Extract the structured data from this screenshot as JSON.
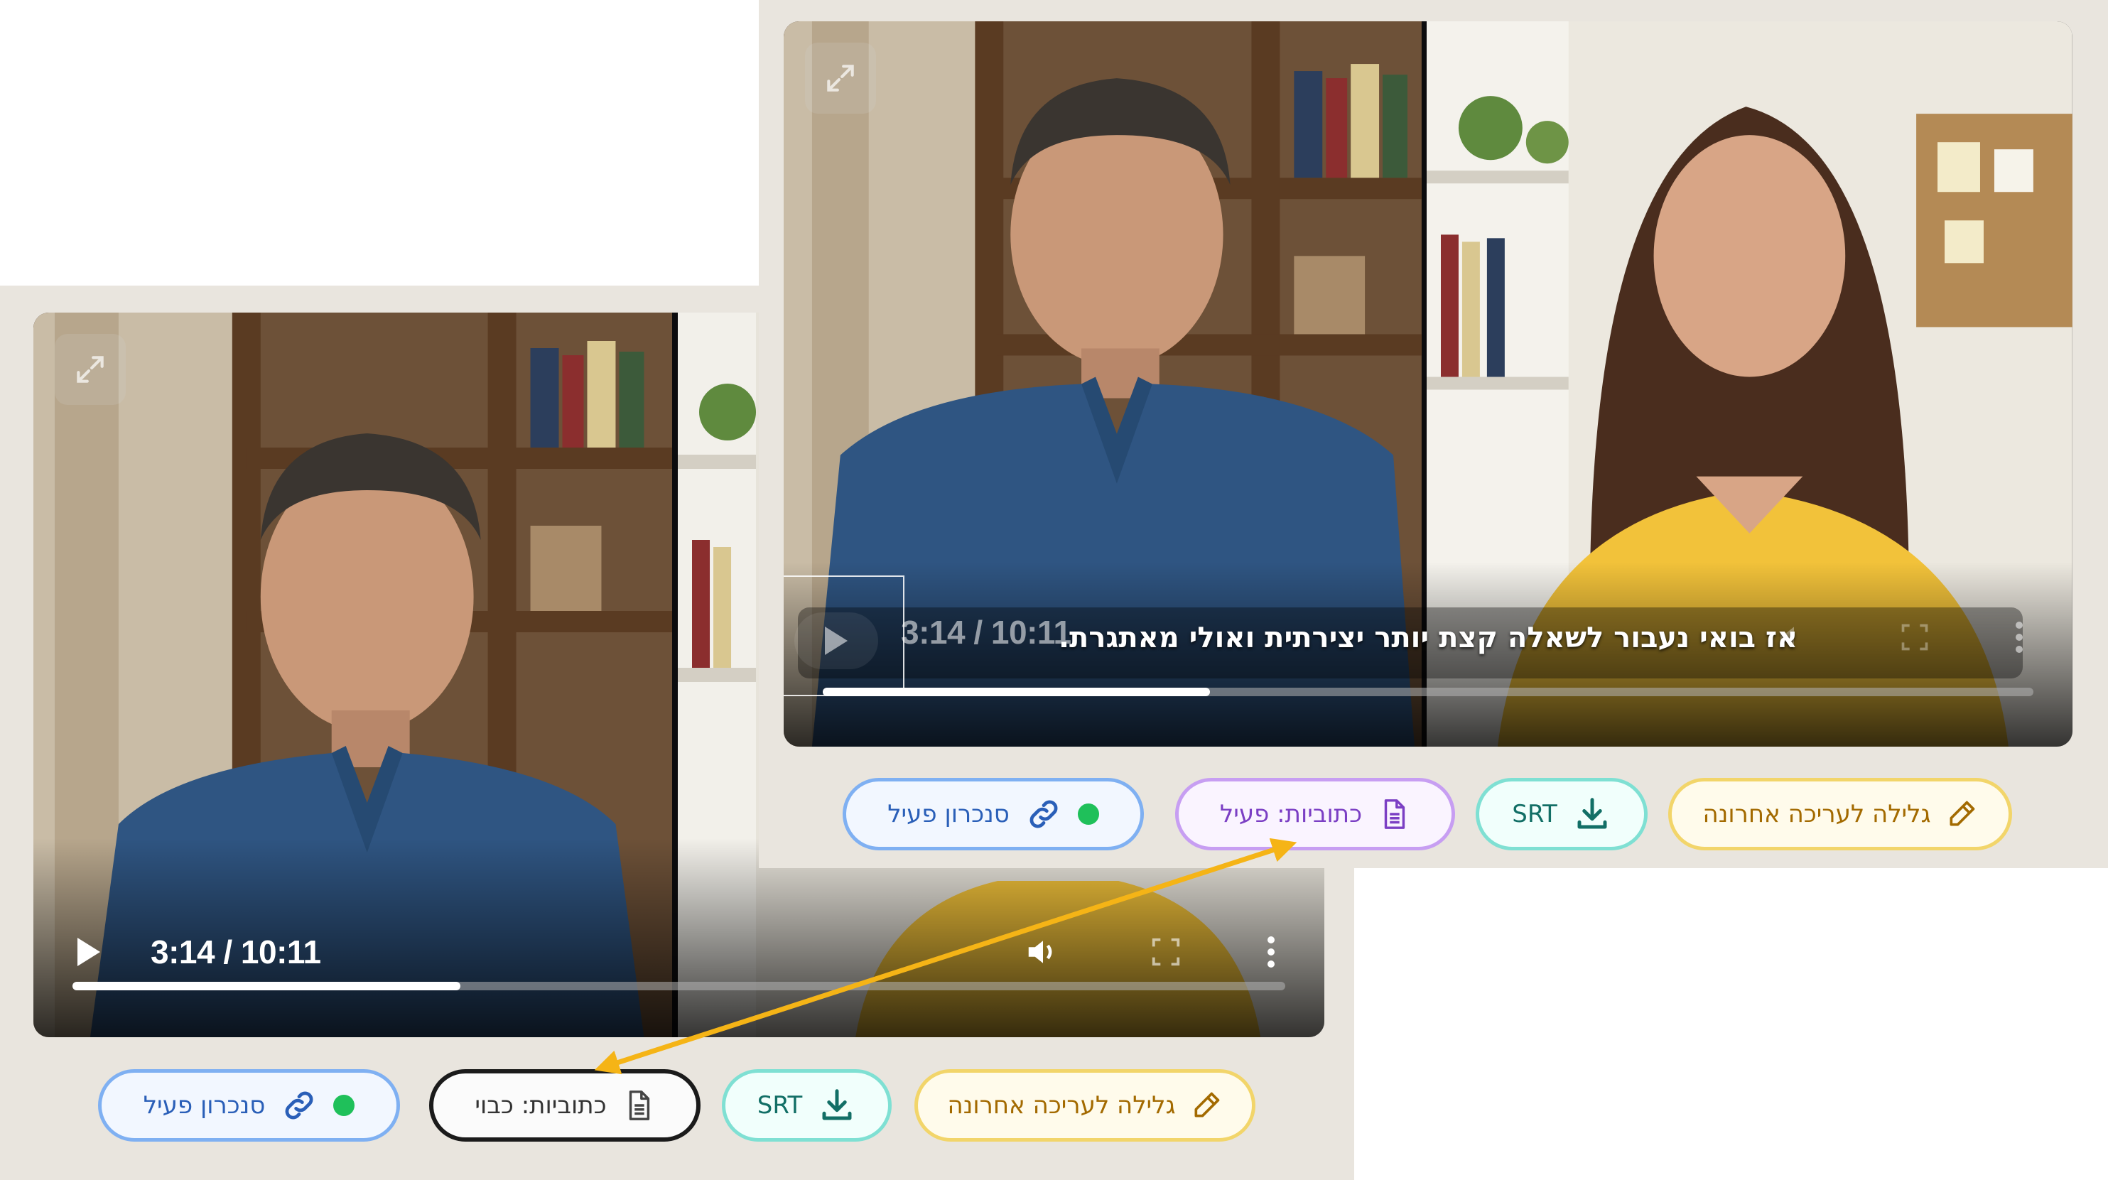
{
  "back_panel": {
    "player": {
      "time": "3:14 / 10:11",
      "progress_fraction": 0.32
    },
    "buttons": {
      "sync": "סנכרון פעיל",
      "captions": "כתוביות: כבוי",
      "srt": "SRT",
      "scroll": "גלילה לעריכה אחרונה"
    }
  },
  "front_panel": {
    "player": {
      "time": "3:14 / 10:11",
      "subtitle": "אז בואי נעבור לשאלה קצת יותר יצירתית ואולי מאתגרת.",
      "progress_fraction": 0.32
    },
    "buttons": {
      "sync": "סנכרון פעיל",
      "captions": "כתוביות: פעיל",
      "srt": "SRT",
      "scroll": "גלילה לעריכה אחרונה"
    }
  },
  "colors": {
    "panel_bg": "#e9e5de",
    "arrow": "#f5b416",
    "sync_border": "#7fb0f2",
    "captions_active_border": "#c79ef2",
    "srt_border": "#7fe0d3",
    "scroll_border": "#f2d56a",
    "status_dot": "#1fc05a"
  },
  "icons": [
    "expand-icon",
    "play-icon",
    "volume-icon",
    "fullscreen-icon",
    "more-vert-icon",
    "link-icon",
    "document-icon",
    "download-icon",
    "pencil-icon"
  ]
}
